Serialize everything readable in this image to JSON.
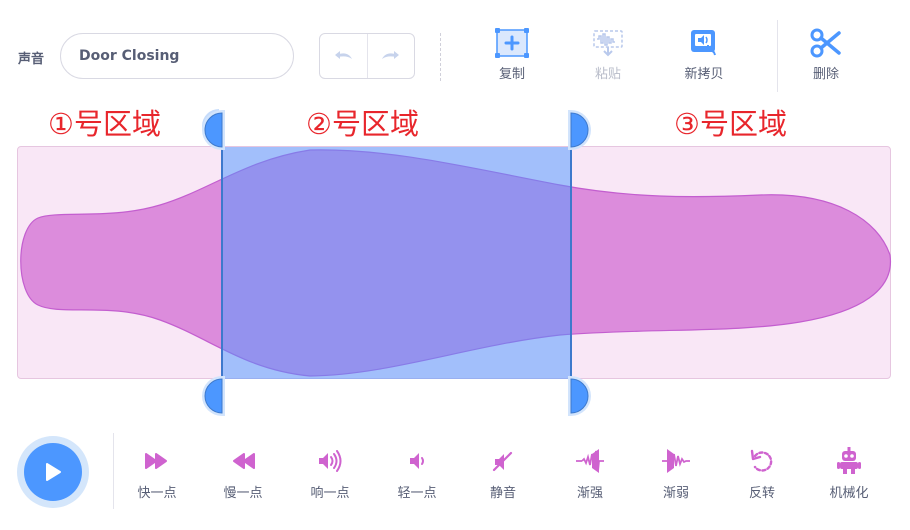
{
  "sound": {
    "label": "声音",
    "name": "Door Closing"
  },
  "toolbar": {
    "copy": "复制",
    "paste": "粘贴",
    "copy_new": "新拷贝",
    "delete": "删除"
  },
  "regions": [
    "①号区域",
    "②号区域",
    "③号区域"
  ],
  "effects": [
    "快一点",
    "慢一点",
    "响一点",
    "轻一点",
    "静音",
    "渐强",
    "渐弱",
    "反转",
    "机械化"
  ],
  "colors": {
    "accent": "#4c97ff",
    "waveform": "#cf63cf",
    "selection": "#4c97ff",
    "region_label": "#e8262c",
    "text": "#575e75"
  },
  "icons": {
    "copy": "copy-icon",
    "paste": "paste-icon",
    "copy_new": "copy-to-new-icon",
    "delete": "scissors-icon",
    "play": "play-icon"
  }
}
